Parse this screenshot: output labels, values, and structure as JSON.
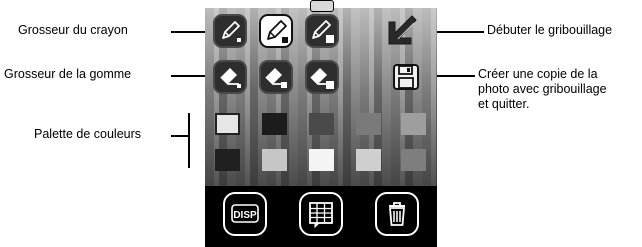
{
  "callouts": {
    "pencil_size": "Grosseur du crayon",
    "eraser_size": "Grosseur de la gomme",
    "color_palette": "Palette de couleurs",
    "start_doodle": "Débuter le gribouillage",
    "save_copy_line1": "Créer une copie de la",
    "save_copy_line2": "photo avec gribouillage",
    "save_copy_line3": "et quitter."
  },
  "toolbar": {
    "pencil_sizes": [
      "small",
      "medium",
      "large"
    ],
    "selected_pencil": "medium",
    "eraser_sizes": [
      "small",
      "medium",
      "large"
    ]
  },
  "palette": {
    "row1": [
      "#e6e6e6",
      "#1c1c1c",
      "#4a4a4a",
      "#7a7a7a",
      "#9e9e9e"
    ],
    "row2": [
      "#202020",
      "#c6c6c6",
      "#f4f4f4",
      "#cfcfcf",
      "#7e7e7e"
    ],
    "selected": "#e6e6e6"
  },
  "bottom_buttons": {
    "disp_label": "DISP",
    "menu_icon": "grid-menu-icon",
    "delete_icon": "trash-icon"
  },
  "colors": {
    "screen_background": "#000000",
    "button_border": "#ffffff",
    "selected_tool": "#ffffff"
  }
}
